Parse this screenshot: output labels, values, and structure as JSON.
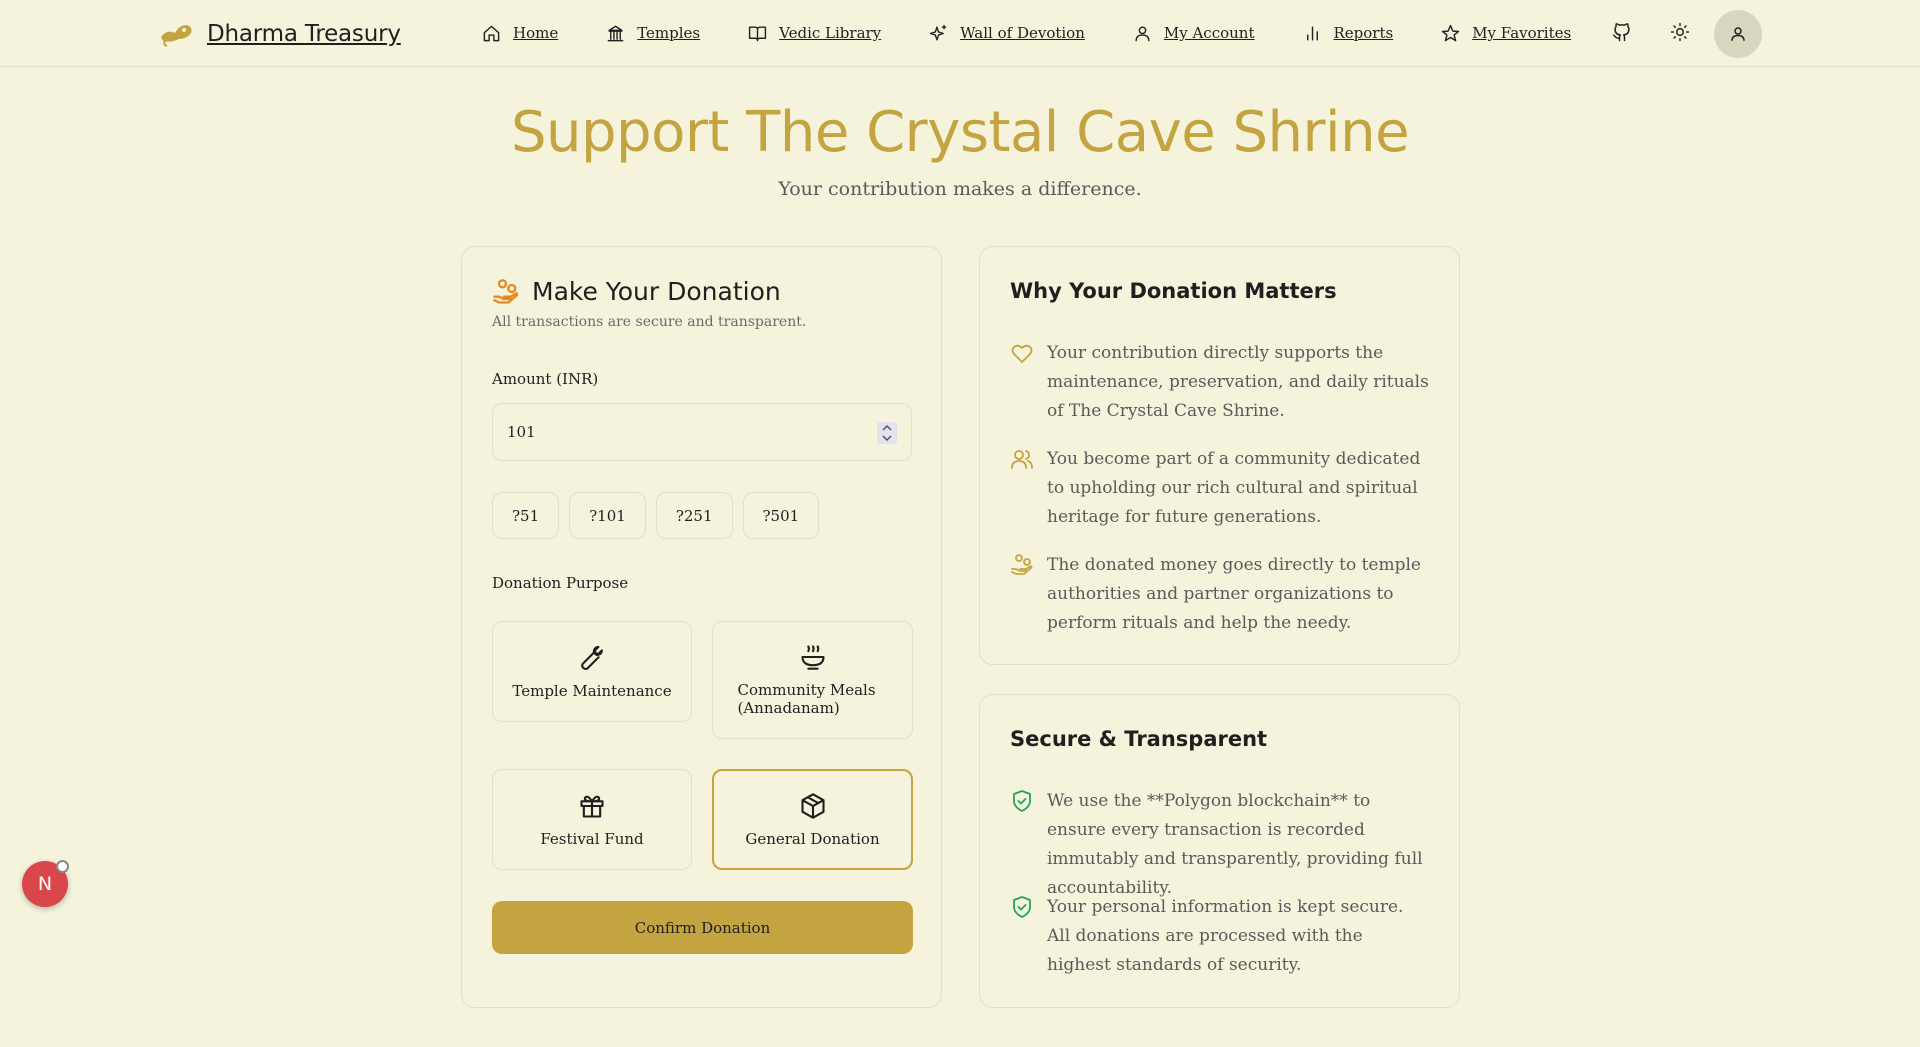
{
  "header": {
    "brand": "Dharma Treasury",
    "nav": [
      {
        "label": "Home",
        "icon": "home-icon"
      },
      {
        "label": "Temples",
        "icon": "temple-icon"
      },
      {
        "label": "Vedic Library",
        "icon": "book-icon"
      },
      {
        "label": "Wall of Devotion",
        "icon": "sparkles-icon"
      },
      {
        "label": "My Account",
        "icon": "user-icon"
      },
      {
        "label": "Reports",
        "icon": "bar-chart-icon"
      },
      {
        "label": "My Favorites",
        "icon": "star-icon"
      }
    ],
    "icons": [
      "github-icon",
      "sun-icon",
      "user-icon"
    ]
  },
  "page": {
    "title": "Support The Crystal Cave Shrine",
    "subtitle": "Your contribution makes a difference."
  },
  "donation": {
    "title": "Make Your Donation",
    "subtitle": "All transactions are secure and transparent.",
    "amount_label": "Amount (INR)",
    "amount_value": "101",
    "quick_amounts": [
      "?51",
      "?101",
      "?251",
      "?501"
    ],
    "purpose_label": "Donation Purpose",
    "purposes": [
      {
        "label": "Temple Maintenance",
        "icon": "wrench-icon",
        "selected": false
      },
      {
        "label": "Community Meals (Annadanam)",
        "icon": "meal-bowl-icon",
        "selected": false
      },
      {
        "label": "Festival Fund",
        "icon": "gift-icon",
        "selected": false
      },
      {
        "label": "General Donation",
        "icon": "package-icon",
        "selected": true
      }
    ],
    "confirm_label": "Confirm Donation"
  },
  "why": {
    "title": "Why Your Donation Matters",
    "points": [
      {
        "icon": "heart-icon",
        "text": "Your contribution directly supports the maintenance, preservation, and daily rituals of The Crystal Cave Shrine."
      },
      {
        "icon": "users-icon",
        "text": "You become part of a community dedicated to upholding our rich cultural and spiritual heritage for future generations."
      },
      {
        "icon": "hand-coins-icon",
        "text": "The donated money goes directly to temple authorities and partner organizations to perform rituals and help the needy."
      }
    ]
  },
  "secure": {
    "title": "Secure & Transparent",
    "points": [
      {
        "icon": "shield-check-icon",
        "text": "We use the **Polygon blockchain** to ensure every transaction is recorded immutably and transparently, providing full accountability."
      },
      {
        "icon": "shield-check-icon",
        "text": "Your personal information is kept secure. All donations are processed with the highest standards of security."
      }
    ]
  },
  "fab": {
    "label": "N"
  },
  "colors": {
    "accent": "#c4a441",
    "background": "#f5f3dc",
    "border": "#e2dfc6",
    "secure_green": "#22a55a",
    "donation_icon": "#e38b1f",
    "fab": "#d9474b"
  }
}
